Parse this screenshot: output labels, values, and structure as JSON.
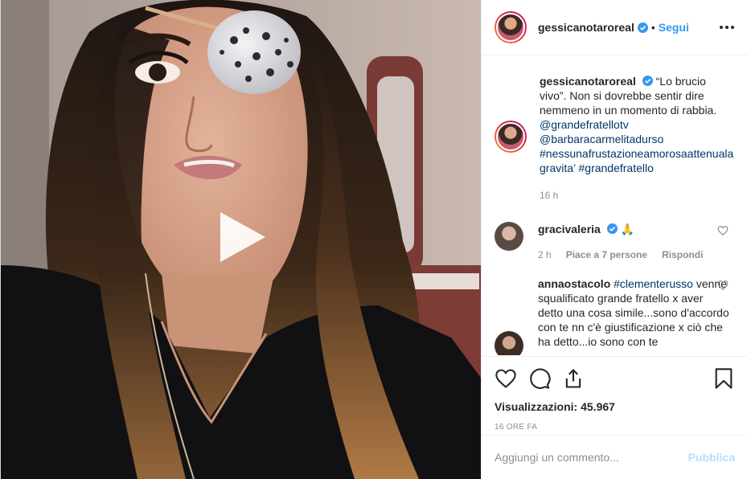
{
  "colors": {
    "accent": "#3897f0",
    "link": "#003569",
    "muted": "#8e8e8e",
    "publish_disabled": "#b2dffc"
  },
  "header": {
    "username": "gessicanotaroreal",
    "separator": "•",
    "follow_label": "Segui",
    "more_icon": "more-horizontal-icon",
    "verified_icon": "verified-badge-icon"
  },
  "caption": {
    "username": "gessicanotaroreal",
    "text": "“Lo brucio vivo”. Non si dovrebbe sentir dire nemmeno in un momento di rabbia.",
    "mentions": [
      "@grandefratellotv",
      "@barbaracarmelitadurso"
    ],
    "hashtags": "#nessunafrustazioneamorosaattenuala gravita’ #grandefratello",
    "time": "16 h"
  },
  "comments": [
    {
      "username": "gracivaleria",
      "text": "🙏",
      "time": "2 h",
      "likes": "Piace a 7 persone",
      "reply_label": "Rispondi"
    },
    {
      "username": "annaostacolo",
      "tag": "#clementerusso",
      "text": "venne squalificato grande fratello x aver detto una cosa simile...sono d'accordo con te nn c'è giustificazione x ciò che ha detto...io sono con te"
    }
  ],
  "actions": {
    "icons": [
      "heart-icon",
      "comment-icon",
      "share-icon",
      "bookmark-icon"
    ],
    "views_label": "Visualizzazioni:",
    "views_count": "45.967",
    "date": "16 ORE FA"
  },
  "add_comment": {
    "placeholder": "Aggiungi un commento...",
    "publish_label": "Pubblica"
  }
}
